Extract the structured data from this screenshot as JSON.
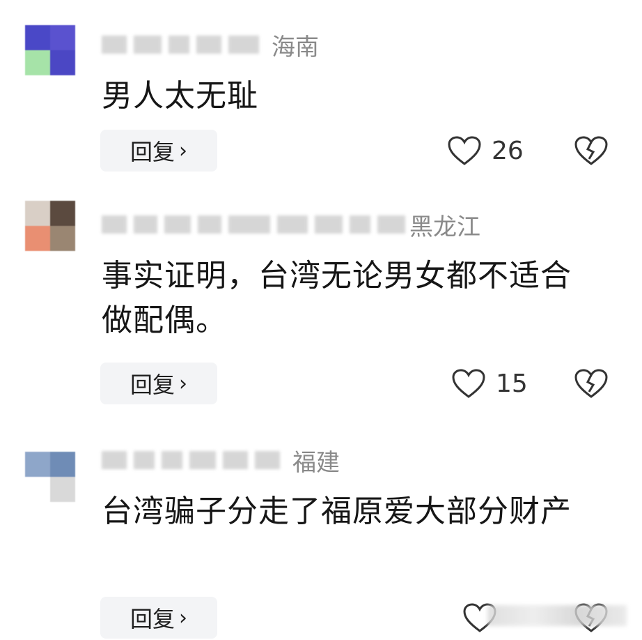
{
  "comments": [
    {
      "location": "海南",
      "text": "男人太无耻",
      "reply_label": "回复",
      "like_count": "26",
      "avatar_colors": [
        "#4a48c7",
        "#5a52cf",
        "#a6e3a8",
        "#4b47c4"
      ]
    },
    {
      "location": "黑龙江",
      "text": "事实证明，台湾无论男女都不适合做配偶。",
      "reply_label": "回复",
      "like_count": "15",
      "avatar_colors": [
        "#d9cfc6",
        "#5b4a3f",
        "#e98f72",
        "#9a8672"
      ]
    },
    {
      "location": "福建",
      "text": "台湾骗子分走了福原爱大部分财产",
      "reply_label": "回复",
      "like_count": "",
      "avatar_colors": [
        "#8ea6c9",
        "#6f8cb6",
        "#ffffff",
        "#d9d9d9"
      ]
    }
  ],
  "icons": {
    "like": "heart-outline-icon",
    "dislike": "broken-heart-icon",
    "reply_chevron": "chevron-right-icon"
  }
}
